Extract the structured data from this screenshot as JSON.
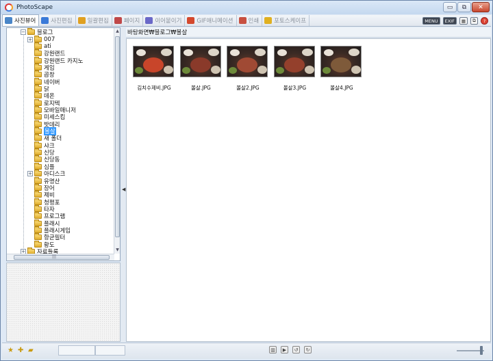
{
  "window": {
    "title": "PhotoScape",
    "controls": {
      "minimize": "▭",
      "maximize": "⧉",
      "close": "✕"
    }
  },
  "tabs": [
    {
      "label": "사진뷰어",
      "icon": "viewer-icon",
      "color": "#4a86c8",
      "active": true
    },
    {
      "label": "사진편집",
      "icon": "editor-icon",
      "color": "#3a7ad8",
      "active": false
    },
    {
      "label": "일괄편집",
      "icon": "batch-icon",
      "color": "#e0a020",
      "active": false
    },
    {
      "label": "페이지",
      "icon": "page-icon",
      "color": "#c04848",
      "active": false
    },
    {
      "label": "이어붙이기",
      "icon": "combine-icon",
      "color": "#6a68c8",
      "active": false
    },
    {
      "label": "GIF애니메이션",
      "icon": "gif-icon",
      "color": "#d4482c",
      "active": false
    },
    {
      "label": "인쇄",
      "icon": "print-icon",
      "color": "#c85040",
      "active": false
    },
    {
      "label": "포토스케이프",
      "icon": "photoscape-icon",
      "color": "#e0b020",
      "active": false
    }
  ],
  "tools": {
    "menu": "MENU",
    "exif": "EXIF"
  },
  "tree": {
    "items": [
      {
        "label": "블로그",
        "level": 1,
        "expander": "−",
        "selected": false
      },
      {
        "label": "007",
        "level": 2,
        "expander": "+",
        "selected": false
      },
      {
        "label": "ati",
        "level": 2,
        "expander": "",
        "selected": false
      },
      {
        "label": "강원랜드",
        "level": 2,
        "expander": "",
        "selected": false
      },
      {
        "label": "강원랜드 카지노",
        "level": 2,
        "expander": "",
        "selected": false
      },
      {
        "label": "게임",
        "level": 2,
        "expander": "",
        "selected": false
      },
      {
        "label": "곱창",
        "level": 2,
        "expander": "",
        "selected": false
      },
      {
        "label": "네이버",
        "level": 2,
        "expander": "",
        "selected": false
      },
      {
        "label": "닭",
        "level": 2,
        "expander": "",
        "selected": false
      },
      {
        "label": "데온",
        "level": 2,
        "expander": "",
        "selected": false
      },
      {
        "label": "로지텍",
        "level": 2,
        "expander": "",
        "selected": false
      },
      {
        "label": "모바일매니저",
        "level": 2,
        "expander": "",
        "selected": false
      },
      {
        "label": "미세스킴",
        "level": 2,
        "expander": "",
        "selected": false
      },
      {
        "label": "밧데리",
        "level": 2,
        "expander": "",
        "selected": false
      },
      {
        "label": "볼살",
        "level": 2,
        "expander": "",
        "selected": true
      },
      {
        "label": "새 폴더",
        "level": 2,
        "expander": "",
        "selected": false
      },
      {
        "label": "샤크",
        "level": 2,
        "expander": "",
        "selected": false
      },
      {
        "label": "신당",
        "level": 2,
        "expander": "",
        "selected": false
      },
      {
        "label": "신당동",
        "level": 2,
        "expander": "",
        "selected": false
      },
      {
        "label": "심플",
        "level": 2,
        "expander": "",
        "selected": false
      },
      {
        "label": "아디스크",
        "level": 2,
        "expander": "+",
        "selected": false
      },
      {
        "label": "유명산",
        "level": 2,
        "expander": "",
        "selected": false
      },
      {
        "label": "장어",
        "level": 2,
        "expander": "",
        "selected": false
      },
      {
        "label": "제비",
        "level": 2,
        "expander": "",
        "selected": false
      },
      {
        "label": "청평포",
        "level": 2,
        "expander": "",
        "selected": false
      },
      {
        "label": "타자",
        "level": 2,
        "expander": "",
        "selected": false
      },
      {
        "label": "프로그램",
        "level": 2,
        "expander": "",
        "selected": false
      },
      {
        "label": "플래시",
        "level": 2,
        "expander": "",
        "selected": false
      },
      {
        "label": "플래시게임",
        "level": 2,
        "expander": "",
        "selected": false
      },
      {
        "label": "항균필터",
        "level": 2,
        "expander": "",
        "selected": false
      },
      {
        "label": "황도",
        "level": 2,
        "expander": "",
        "selected": false
      },
      {
        "label": "자료들록",
        "level": 1,
        "expander": "+",
        "selected": false
      }
    ]
  },
  "path": "바탕화면₩블로그₩볼살",
  "thumbnails": [
    {
      "name": "김치수제비.JPG",
      "accent": "#c8452a"
    },
    {
      "name": "볼살.JPG",
      "accent": "#8a3a2a"
    },
    {
      "name": "볼살2.JPG",
      "accent": "#a04a34"
    },
    {
      "name": "볼살3.JPG",
      "accent": "#94402c"
    },
    {
      "name": "볼살4.JPG",
      "accent": "#7e5a3a"
    }
  ],
  "statusbar": {
    "icons": [
      "star-icon",
      "favorites-icon",
      "folder-icon"
    ]
  }
}
